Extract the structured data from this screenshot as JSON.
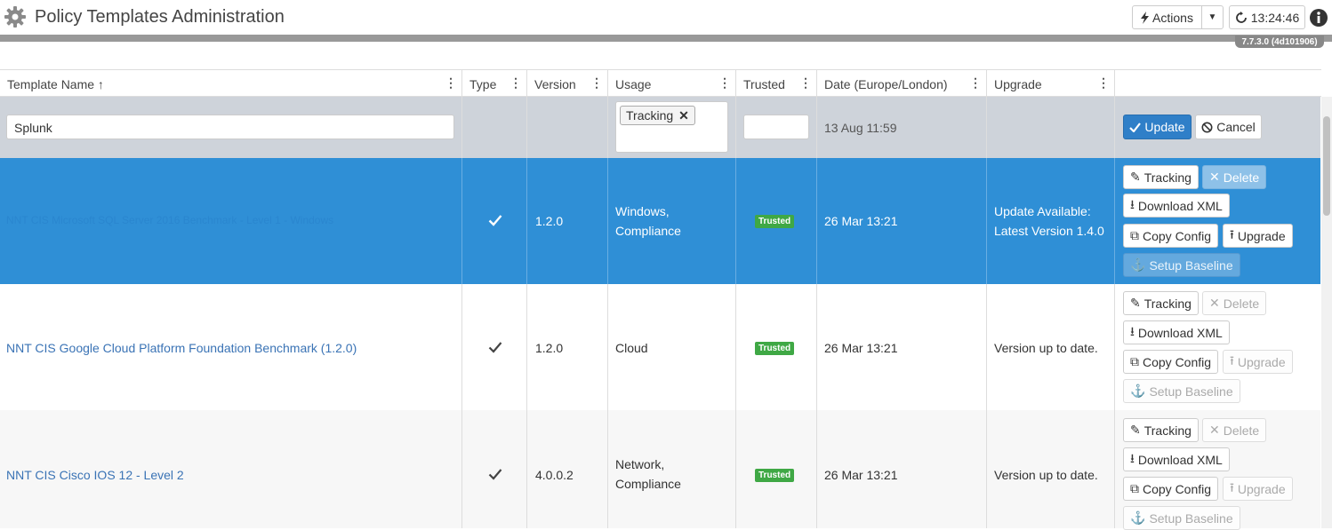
{
  "header": {
    "title": "Policy Templates Administration",
    "actions_label": "Actions",
    "clock": "13:24:46",
    "version": "7.7.3.0 (4d101906)"
  },
  "columns": {
    "name": "Template Name",
    "type": "Type",
    "version": "Version",
    "usage": "Usage",
    "trusted": "Trusted",
    "date": "Date (Europe/London)",
    "upgrade": "Upgrade"
  },
  "filter": {
    "name_value": "Splunk",
    "usage_tag": "Tracking",
    "date": "13 Aug 11:59",
    "update_label": "Update",
    "cancel_label": "Cancel"
  },
  "rows": [
    {
      "name": "NNT CIS Microsoft SQL Server 2016 Benchmark - Level 1 - Windows",
      "version": "1.2.0",
      "usage_1": "Windows,",
      "usage_2": "Compliance",
      "trusted": "Trusted",
      "date": "26 Mar 13:21",
      "upgrade_1": "Update Available:",
      "upgrade_2": "Latest Version 1.4.0"
    },
    {
      "name": "NNT CIS Google Cloud Platform Foundation Benchmark (1.2.0)",
      "version": "1.2.0",
      "usage_1": "Cloud",
      "usage_2": "",
      "trusted": "Trusted",
      "date": "26 Mar 13:21",
      "upgrade_1": "Version up to date.",
      "upgrade_2": ""
    },
    {
      "name": "NNT CIS Cisco IOS 12 - Level 2",
      "version": "4.0.0.2",
      "usage_1": "Network,",
      "usage_2": "Compliance",
      "trusted": "Trusted",
      "date": "26 Mar 13:21",
      "upgrade_1": "Version up to date.",
      "upgrade_2": ""
    }
  ],
  "row_actions": {
    "tracking": "Tracking",
    "delete": "Delete",
    "download": "Download XML",
    "copy": "Copy Config",
    "upgrade": "Upgrade",
    "baseline": "Setup Baseline"
  }
}
